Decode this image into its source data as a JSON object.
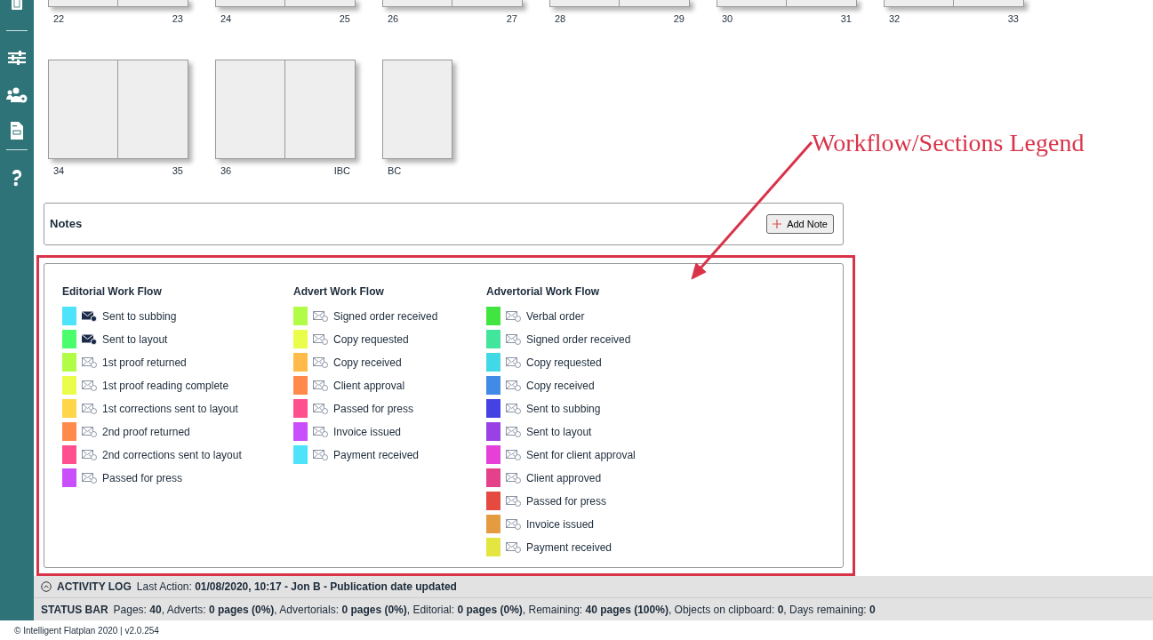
{
  "flatplan": {
    "rows": [
      {
        "cut": true,
        "spreads": [
          {
            "pages": [
              "22",
              "23"
            ]
          },
          {
            "pages": [
              "24",
              "25"
            ]
          },
          {
            "pages": [
              "26",
              "27"
            ]
          },
          {
            "pages": [
              "28",
              "29"
            ]
          },
          {
            "pages": [
              "30",
              "31"
            ]
          },
          {
            "pages": [
              "32",
              "33"
            ]
          }
        ]
      },
      {
        "cut": false,
        "spreads": [
          {
            "pages": [
              "34",
              "35"
            ]
          },
          {
            "pages": [
              "36",
              "IBC"
            ]
          },
          {
            "pages": [
              "BC"
            ]
          }
        ]
      }
    ]
  },
  "notes": {
    "title": "Notes",
    "add_button": "Add Note"
  },
  "legend": {
    "columns": [
      {
        "title": "Editorial Work Flow",
        "items": [
          {
            "label": "Sent to subbing",
            "color": "#4de3fb",
            "filled_icon": true
          },
          {
            "label": "Sent to layout",
            "color": "#4afd6c",
            "filled_icon": true
          },
          {
            "label": "1st proof returned",
            "color": "#b1fc47",
            "filled_icon": false
          },
          {
            "label": "1st proof reading complete",
            "color": "#ebfd4b",
            "filled_icon": false
          },
          {
            "label": "1st corrections sent to layout",
            "color": "#ffd54a",
            "filled_icon": false
          },
          {
            "label": "2nd proof returned",
            "color": "#ff8a4c",
            "filled_icon": false
          },
          {
            "label": "2nd corrections sent to layout",
            "color": "#ff4f8e",
            "filled_icon": false
          },
          {
            "label": "Passed for press",
            "color": "#c84ffb",
            "filled_icon": false
          }
        ]
      },
      {
        "title": "Advert Work Flow",
        "items": [
          {
            "label": "Signed order received",
            "color": "#b1fc47",
            "filled_icon": false
          },
          {
            "label": "Copy requested",
            "color": "#ebfd4b",
            "filled_icon": false
          },
          {
            "label": "Copy received",
            "color": "#ffbb4a",
            "filled_icon": false
          },
          {
            "label": "Client approval",
            "color": "#ff8a4c",
            "filled_icon": false
          },
          {
            "label": "Passed for press",
            "color": "#ff4f8e",
            "filled_icon": false
          },
          {
            "label": "Invoice issued",
            "color": "#c84ffb",
            "filled_icon": false
          },
          {
            "label": "Payment received",
            "color": "#4de3fb",
            "filled_icon": false
          }
        ]
      },
      {
        "title": "Advertorial Work Flow",
        "items": [
          {
            "label": "Verbal order",
            "color": "#41e540",
            "filled_icon": false
          },
          {
            "label": "Signed order received",
            "color": "#41e59c",
            "filled_icon": false
          },
          {
            "label": "Copy requested",
            "color": "#41d9e5",
            "filled_icon": false
          },
          {
            "label": "Copy received",
            "color": "#418ae5",
            "filled_icon": false
          },
          {
            "label": "Sent to subbing",
            "color": "#4541e5",
            "filled_icon": false
          },
          {
            "label": "Sent to layout",
            "color": "#9a41e5",
            "filled_icon": false
          },
          {
            "label": "Sent for client approval",
            "color": "#e541d9",
            "filled_icon": false
          },
          {
            "label": "Client approved",
            "color": "#e5418a",
            "filled_icon": false
          },
          {
            "label": "Passed for press",
            "color": "#e54a41",
            "filled_icon": false
          },
          {
            "label": "Invoice issued",
            "color": "#e59c41",
            "filled_icon": false
          },
          {
            "label": "Payment received",
            "color": "#e5e541",
            "filled_icon": false
          }
        ]
      }
    ]
  },
  "annotation": {
    "label": "Workflow/Sections Legend"
  },
  "activity_log": {
    "label": "ACTIVITY LOG",
    "text": "Last Action: **01/08/2020, 10:17 - Jon B - Publication date updated**"
  },
  "status_bar": {
    "label": "STATUS BAR",
    "text": "Pages: **40**, Adverts: **0 pages (0%)**, Advertorials: **0 pages (0%)**, Editorial: **0 pages (0%)**, Remaining: **40 pages (100%)**, Objects on clipboard: **0**, Days remaining: **0**"
  },
  "footer": "© Intelligent Flatplan 2020 | v2.0.254"
}
